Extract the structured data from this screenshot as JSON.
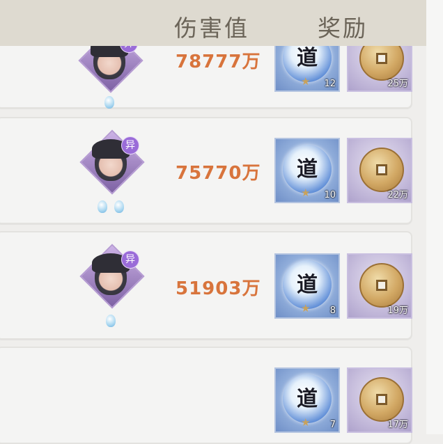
{
  "header": {
    "damage_label": "伤害值",
    "reward_label": "奖励"
  },
  "rows": [
    {
      "damage": "78777万",
      "avatar_badge": "异",
      "dao_count": "12",
      "coin_count": "25万"
    },
    {
      "damage": "75770万",
      "avatar_badge": "异",
      "dao_count": "10",
      "coin_count": "22万"
    },
    {
      "damage": "51903万",
      "avatar_badge": "异",
      "dao_count": "8",
      "coin_count": "19万"
    },
    {
      "damage": "",
      "avatar_badge": "",
      "dao_count": "7",
      "coin_count": "17万"
    }
  ],
  "reward_icons": {
    "dao_glyph": "道",
    "star_glyph": "★",
    "dao_icon": "dao-token-icon",
    "coin_icon": "copper-coin-icon"
  },
  "colors": {
    "damage_text": "#d8743c",
    "header_bg": "#dedad0",
    "row_bg": "#f4f4f3",
    "avatar_frame": "#9a6cd8"
  }
}
